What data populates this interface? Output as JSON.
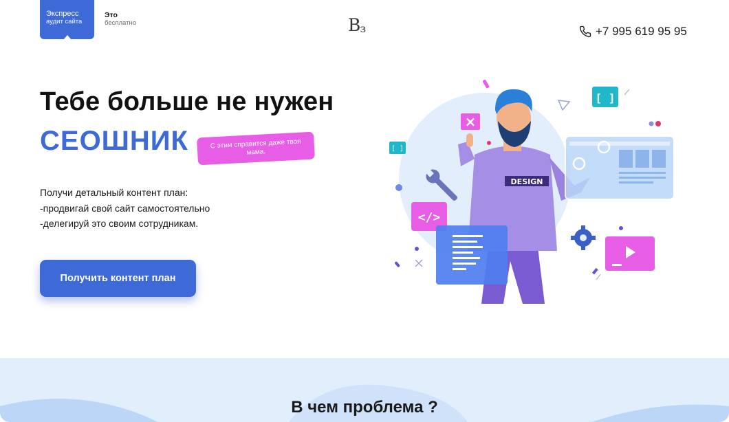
{
  "header": {
    "audit_badge": {
      "line1": "Экспресс",
      "line2": "аудит сайта"
    },
    "free_note": {
      "line1": "Это",
      "line2": "бесплатно"
    },
    "logo": {
      "main": "B",
      "sub": "з"
    },
    "phone": "+7 995 619 95 95"
  },
  "hero": {
    "headline": "Тебе больше не нужен",
    "accent_word": "СЕОШНИК",
    "tag": "С этим справится даже твоя мама.",
    "description": [
      "Получи детальный контент план:",
      "-продвигай свой сайт самостоятельно",
      "-делегируй это своим сотрудникам."
    ],
    "cta_label": "Получить контент план",
    "illustration": {
      "shirt_text": "DESIGN",
      "code_badge": "</>",
      "bracket_badge": "[ ]",
      "small_bracket_badge": "[ ]",
      "close_badge": "×"
    }
  },
  "section2": {
    "title": "В чем проблема ?"
  },
  "colors": {
    "accent": "#3d6ad6",
    "pink": "#e75de6",
    "band": "#e1effd",
    "purple": "#8e72d6",
    "teal": "#1fb7c9"
  }
}
